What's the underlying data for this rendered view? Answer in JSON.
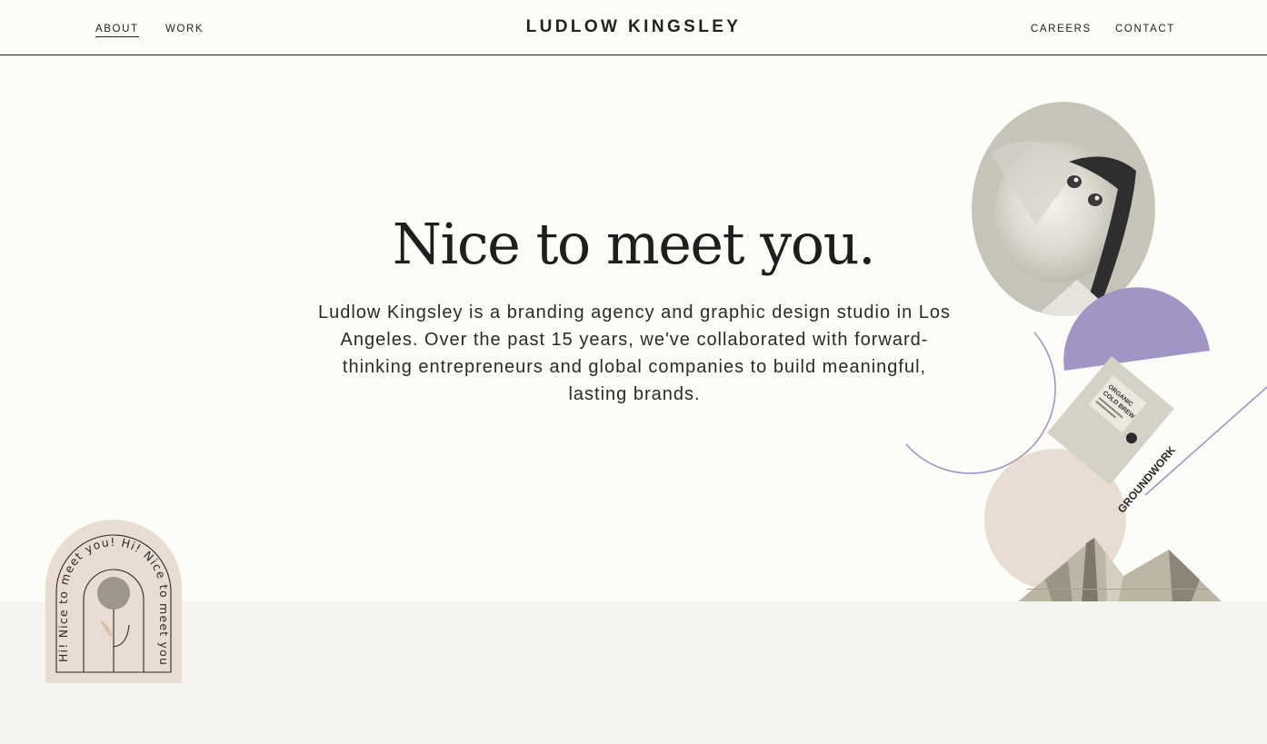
{
  "nav": {
    "about": "ABOUT",
    "work": "WORK",
    "brand": "LUDLOW KINGSLEY",
    "careers": "CAREERS",
    "contact": "CONTACT"
  },
  "hero": {
    "title": "Nice to meet you.",
    "body": "Ludlow Kingsley is a branding agency and graphic design studio in Los Angeles. Over the past 15 years, we've collaborated with forward-thinking entrepreneurs and global companies to build meaningful, lasting brands."
  },
  "collage": {
    "coffee_label_1": "ORGANIC",
    "coffee_label_2": "COLD BREW",
    "coffee_brand": "GROUNDWORK"
  },
  "badge": {
    "arc_text": "Hi! Nice to meet you! Hi! Nice to meet you!"
  },
  "colors": {
    "background": "#fcfcf8",
    "band": "#f6f4ef",
    "lavender": "#a394c6",
    "blush": "#e9ddd3",
    "ink": "#222222"
  }
}
